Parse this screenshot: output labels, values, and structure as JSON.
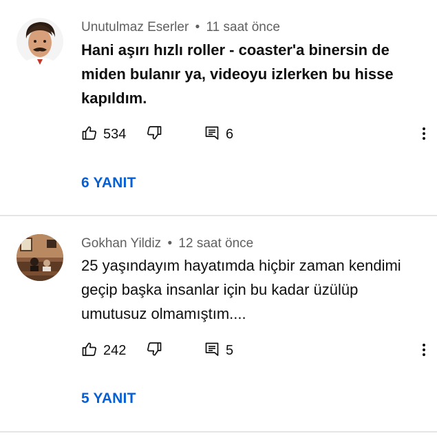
{
  "comments": [
    {
      "author": "Unutulmaz Eserler",
      "time": "11 saat önce",
      "separator": "•",
      "text": "Hani aşırı hızlı roller - coaster'a binersin de miden bulanır ya, videoyu izlerken bu hisse kapıldım.",
      "likes": "534",
      "replies_count": "6",
      "replies_label": "6 YANIT",
      "avatar_icon": "user-avatar-photo"
    },
    {
      "author": "Gokhan Yildiz",
      "time": "12 saat önce",
      "separator": "•",
      "text": "25 yaşındayım hayatımda hiçbir zaman kendimi geçip başka insanlar için bu kadar üzülüp umutusuz olmamıştım....",
      "likes": "242",
      "replies_count": "5",
      "replies_label": "5 YANIT",
      "avatar_icon": "user-avatar-photo"
    }
  ],
  "icons": {
    "like": "thumbs-up-icon",
    "dislike": "thumbs-down-icon",
    "reply": "reply-comment-icon",
    "more": "more-vertical-icon"
  },
  "colors": {
    "link": "#065fd4",
    "meta": "#606060",
    "text": "#0f0f0f",
    "divider": "#e5e5e5"
  }
}
